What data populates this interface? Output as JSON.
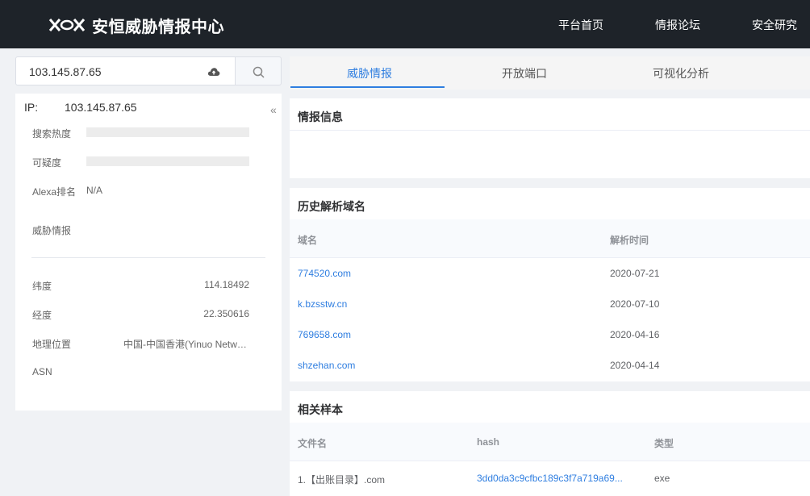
{
  "header": {
    "logo_text": "安恒威胁情报中心",
    "nav": [
      "平台首页",
      "情报论坛",
      "安全研究"
    ]
  },
  "search": {
    "value": "103.145.87.65"
  },
  "ip_panel": {
    "ip_label": "IP:",
    "ip_value": "103.145.87.65",
    "collapse": "«",
    "search_heat_label": "搜索热度",
    "suspicion_label": "可疑度",
    "alexa_label": "Alexa排名",
    "alexa_value": "N/A",
    "threat_label": "威胁情报",
    "latitude_label": "纬度",
    "latitude_value": "114.18492",
    "longitude_label": "经度",
    "longitude_value": "22.350616",
    "geo_label": "地理位置",
    "geo_value": "中国-中国香港(Yinuo Network...",
    "asn_label": "ASN"
  },
  "tabs": [
    "威胁情报",
    "开放端口",
    "可视化分析"
  ],
  "intel_card": {
    "title": "情报信息"
  },
  "domain_card": {
    "title": "历史解析域名",
    "col_domain": "域名",
    "col_time": "解析时间",
    "rows": [
      {
        "domain": "774520.com",
        "time": "2020-07-21"
      },
      {
        "domain": "k.bzsstw.cn",
        "time": "2020-07-10"
      },
      {
        "domain": "769658.com",
        "time": "2020-04-16"
      },
      {
        "domain": "shzehan.com",
        "time": "2020-04-14"
      }
    ]
  },
  "sample_card": {
    "title": "相关样本",
    "col_file": "文件名",
    "col_hash": "hash",
    "col_type": "类型",
    "rows": [
      {
        "file": "1.【出账目录】.com",
        "hash": "3dd0da3c9cfbc189c3f7a719a69...",
        "type": "exe"
      }
    ]
  },
  "colors": {
    "accent": "#2f7ee0",
    "topbar": "#1e2329"
  },
  "icons": [
    "logo-icon",
    "upload-cloud-icon",
    "search-icon"
  ]
}
